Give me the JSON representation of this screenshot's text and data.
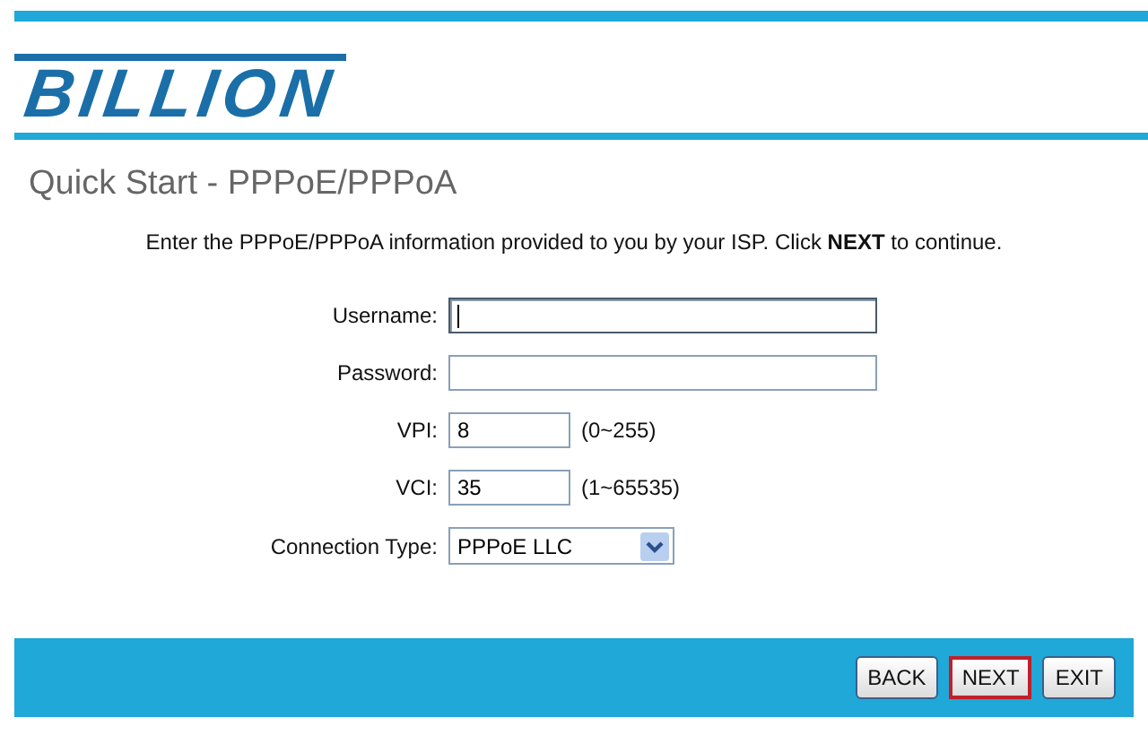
{
  "logo": {
    "text": "BILLION"
  },
  "title": "Quick Start - PPPoE/PPPoA",
  "instruction": "Enter the PPPoE/PPPoA information provided to you by your ISP. Click **NEXT** to continue.",
  "fields": [
    {
      "kind": "text",
      "label": "Username:",
      "focused": true
    },
    {
      "kind": "password",
      "label": "Password:",
      "focused": false
    },
    {
      "kind": "short",
      "label": "VPI:",
      "value": "8",
      "hint": "(0~255)",
      "focused": false
    },
    {
      "kind": "short",
      "label": "VCI:",
      "value": "35",
      "hint": "(1~65535)",
      "focused": false
    },
    {
      "kind": "select",
      "label": "Connection Type:",
      "value": "PPPoE LLC",
      "focused": false
    }
  ],
  "buttons": [
    {
      "label": "BACK",
      "highlighted": false
    },
    {
      "label": "NEXT",
      "highlighted": true
    },
    {
      "label": "EXIT",
      "highlighted": false
    }
  ]
}
